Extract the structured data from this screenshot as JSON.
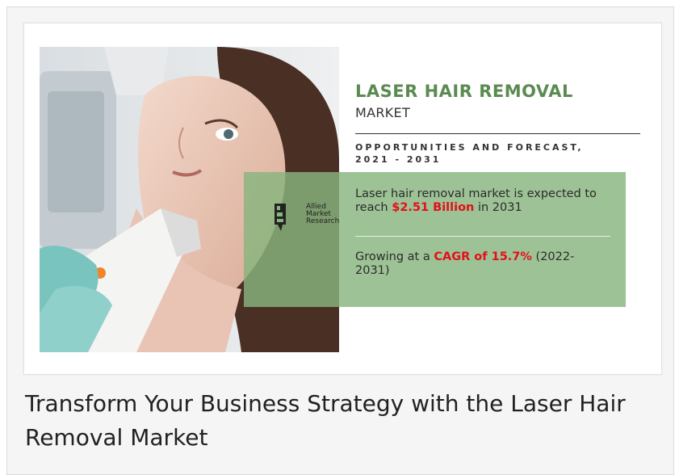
{
  "infographic": {
    "title": "LASER HAIR REMOVAL",
    "subtitle": "MARKET",
    "tagline": "OPPORTUNITIES AND FORECAST, 2021 - 2031",
    "stat1": {
      "prefix": "Laser hair removal market is expected to reach ",
      "highlight": "$2.51 Billion",
      "suffix": " in 2031"
    },
    "stat2": {
      "prefix": "Growing at a ",
      "highlight": "CAGR of 15.7%",
      "suffix": " (2022-2031)"
    },
    "logo": {
      "line1": "Allied",
      "line2": "Market",
      "line3": "Research"
    },
    "colors": {
      "title": "#5b8a52",
      "highlight": "#e3101a",
      "panel": "#88b57e"
    }
  },
  "caption": "Transform Your Business Strategy with the Laser Hair Removal Market"
}
